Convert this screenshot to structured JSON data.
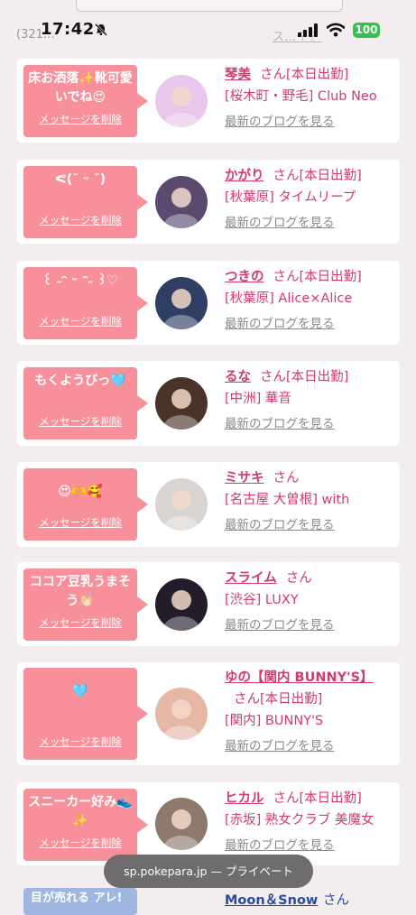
{
  "status_bar": {
    "time": "17:42",
    "battery": "100",
    "faint_left": "(321…",
    "faint_right": "ス… ? ？"
  },
  "url_bar": {
    "label": "sp.pokepara.jp — プライベート"
  },
  "common": {
    "delete_label": "メッセージを削除",
    "blog_label": "最新のブログを見る",
    "san_label": "さん"
  },
  "entries": [
    {
      "message": "床お洒落✨靴可愛いでね😍",
      "name": "琴美",
      "status": "[本日出勤]",
      "shop": "[桜木町・野毛] Club Neo",
      "avatar_color": "#e9c7ec"
    },
    {
      "message": "ᕙ(˘ ᵕ ˘)",
      "name": "かがり",
      "status": "[本日出勤]",
      "shop": "[秋葉原] タイムリープ",
      "avatar_color": "#5a4a70"
    },
    {
      "message": "꒰ ˶ᵔ ᵕ ᵔ˶ ꒱♡",
      "name": "つきの",
      "status": "[本日出勤]",
      "shop": "[秋葉原] Alice×Alice",
      "avatar_color": "#2f3f63"
    },
    {
      "message": "もくようびっ🩵",
      "name": "るな",
      "status": "[本日出勤]",
      "shop": "[中洲] 華音",
      "avatar_color": "#4a3328"
    },
    {
      "message": "😍🫶🥰",
      "name": "ミサキ",
      "status": "",
      "shop": "[名古屋 大曽根] with",
      "avatar_color": "#d9d4d1"
    },
    {
      "message": "ココア豆乳うまそう👏🏻",
      "name": "スライム",
      "status": "",
      "shop": "[渋谷] LUXY",
      "avatar_color": "#241c2a"
    },
    {
      "message": "🩵",
      "name": "ゆの【関内 BUNNY'S】",
      "status": "[本日出勤]",
      "shop": "[関内] BUNNY'S",
      "avatar_color": "#e7b7a6"
    },
    {
      "message": "スニーカー好み👟✨",
      "name": "ヒカル",
      "status": "[本日出勤]",
      "shop": "[赤坂] 熟女クラブ 美魔女",
      "avatar_color": "#8e7a6d"
    }
  ],
  "peek": {
    "message": "目が売れる アレ!",
    "name": "Moon＆Snow",
    "san": "さん"
  }
}
